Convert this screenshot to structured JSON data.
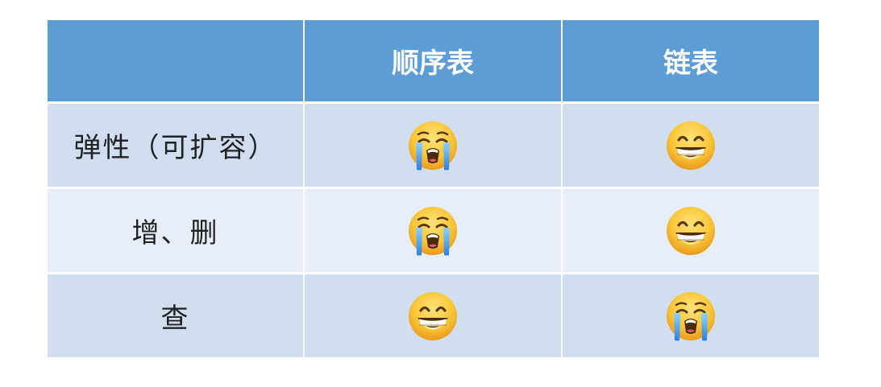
{
  "header": {
    "corner": "",
    "columns": [
      "顺序表",
      "链表"
    ]
  },
  "rows": [
    {
      "label": "弹性（可扩容）",
      "icons": [
        "crying-face-icon",
        "grinning-face-icon"
      ]
    },
    {
      "label": "增、删",
      "icons": [
        "crying-face-icon",
        "grinning-face-icon"
      ]
    },
    {
      "label": "查",
      "icons": [
        "grinning-face-icon",
        "crying-face-icon"
      ]
    }
  ],
  "colors": {
    "header_bg": "#5d9dd5",
    "row_odd_bg": "#d1deef",
    "row_even_bg": "#e8eef7",
    "header_text": "#ffffff"
  }
}
